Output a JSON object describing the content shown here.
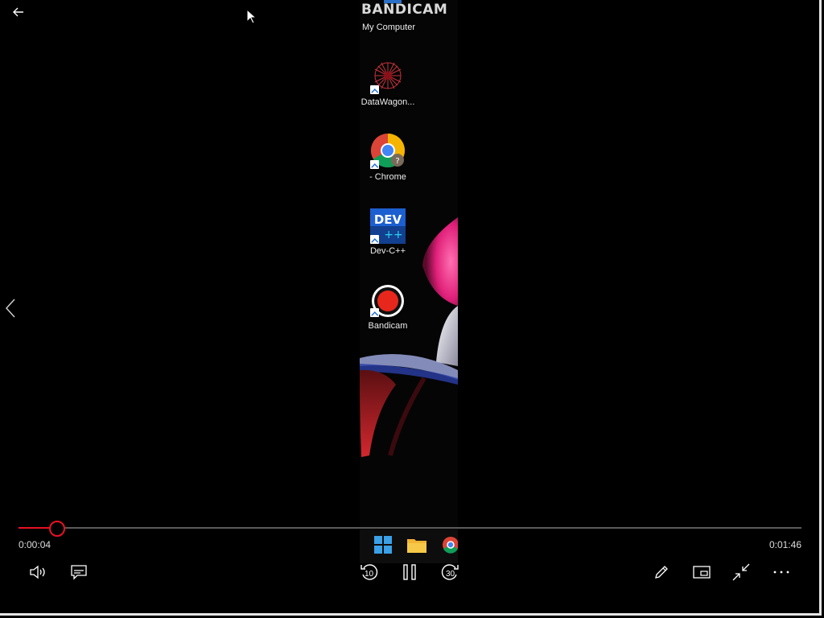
{
  "video": {
    "brand_text": "BANDICAM",
    "desktop_icons": [
      {
        "label": "My Computer"
      },
      {
        "label": "DataWagon..."
      },
      {
        "label": "- Chrome"
      },
      {
        "label": "Dev-C++",
        "icon_text": "DEV"
      },
      {
        "label": "Bandicam"
      }
    ]
  },
  "player": {
    "current_time": "0:00:04",
    "total_time": "0:01:46",
    "progress_fraction": 0.049,
    "skip_back_seconds": "10",
    "skip_forward_seconds": "30",
    "accent_color": "#e81123"
  },
  "icons": {
    "back": "arrow-left-icon",
    "prev": "chevron-left-icon",
    "volume": "speaker-icon",
    "subtitles": "subtitles-icon",
    "skip_back": "rewind-10-icon",
    "play_pause": "pause-icon",
    "skip_forward": "forward-30-icon",
    "edit": "pencil-icon",
    "mini_view": "mini-view-icon",
    "exit_fullscreen": "shrink-icon",
    "more": "more-icon"
  }
}
